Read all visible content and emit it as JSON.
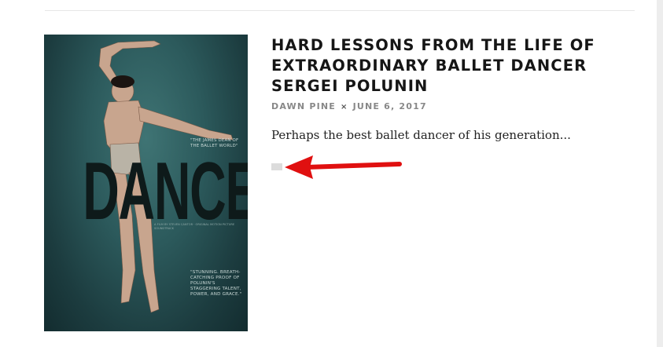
{
  "poster": {
    "word": "DANCER",
    "quote_top": "\"The James Dean of the ballet world\"",
    "credits": "A film by Steven Cantor · Original motion picture soundtrack",
    "quote_bottom": "\"Stunning. Breath-catching proof of Polunin's staggering talent, power, and grace.\""
  },
  "post": {
    "title": "HARD LESSONS FROM THE LIFE OF EXTRAORDINARY BALLET DANCER SERGEI POLUNIN",
    "author": "DAWN PINE",
    "separator": "×",
    "date": "JUNE 6, 2017",
    "excerpt": "Perhaps the best ballet dancer of his generation..."
  },
  "annotation": {
    "arrow_color": "#e01010"
  },
  "colors": {
    "title": "#161616",
    "meta": "#888888",
    "poster_bg": "#2c5a5c"
  }
}
